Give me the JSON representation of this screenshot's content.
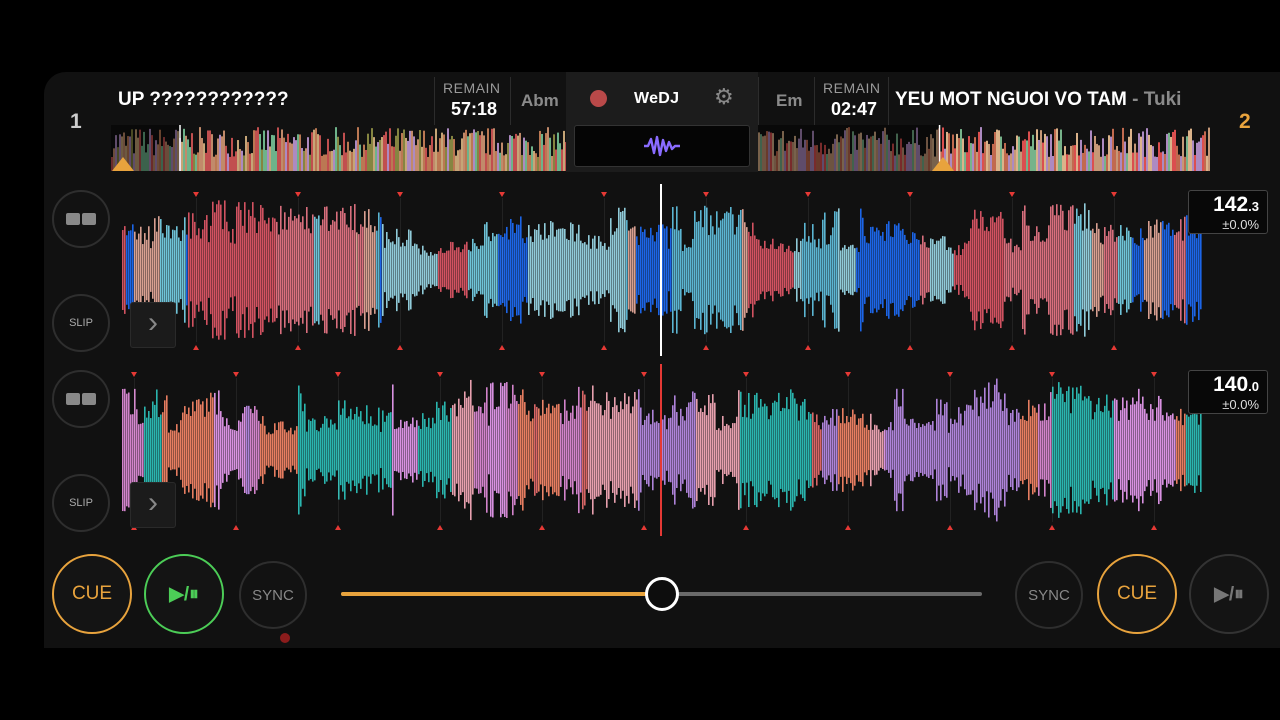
{
  "deck1": {
    "number": "1",
    "title": "UP ????????????",
    "remain_label": "REMAIN",
    "remain": "57:18",
    "key": "Abm",
    "bpm_int": "142",
    "bpm_dec": ".3",
    "pitch": "±0.0%",
    "slip": "SLIP",
    "cue": "CUE",
    "play": "▶/⏸",
    "sync": "SYNC"
  },
  "deck2": {
    "number": "2",
    "title": "YEU MOT NGUOI VO TAM",
    "separator": " - ",
    "artist": "Tuki",
    "remain_label": "REMAIN",
    "remain": "02:47",
    "key": "Em",
    "bpm_int": "140",
    "bpm_dec": ".0",
    "pitch": "±0.0%",
    "slip": "SLIP",
    "cue": "CUE",
    "play": "▶/⏸",
    "sync": "SYNC"
  },
  "center": {
    "brand": "WeDJ",
    "record_icon": "record-icon",
    "settings_icon": "gear-icon",
    "waveform_icon": "waveform-icon"
  },
  "crossfader": {
    "position": 0.5
  },
  "colors": {
    "accent_orange": "#e8a33d",
    "play_green": "#4ccd57",
    "playhead_red": "#e53935",
    "background": "#111111"
  }
}
